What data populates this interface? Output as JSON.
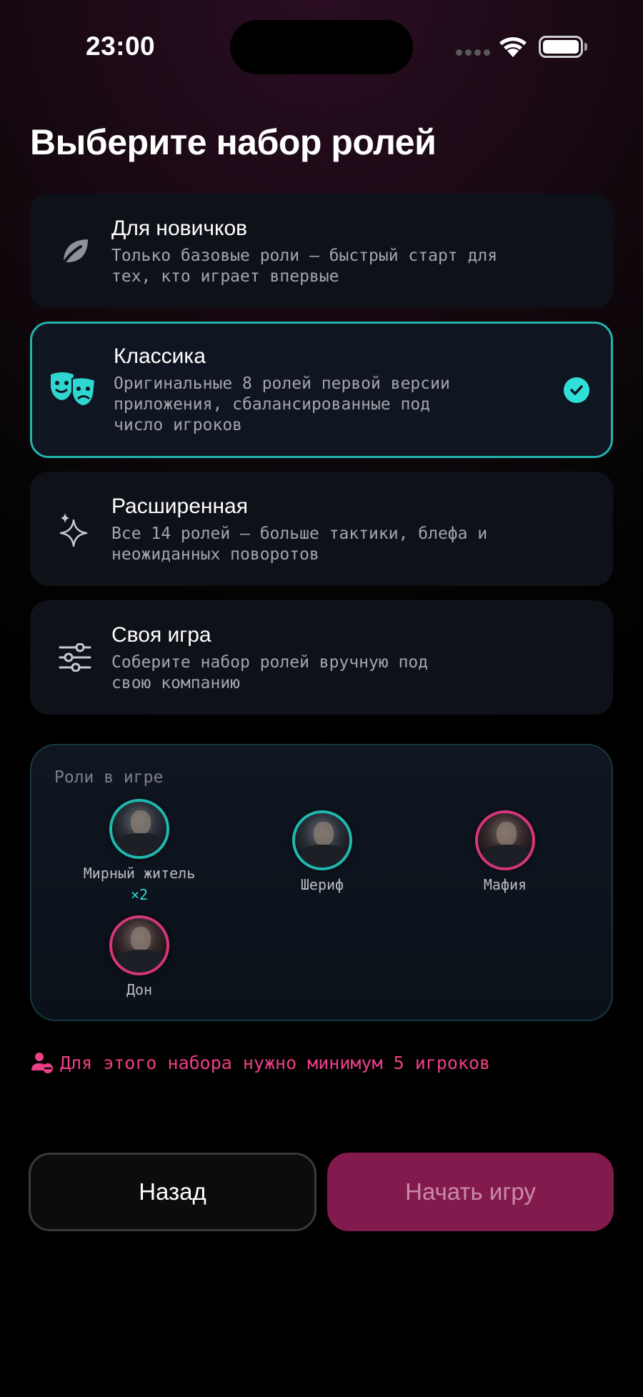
{
  "status_bar": {
    "time": "23:00"
  },
  "title": "Выберите набор ролей",
  "options": [
    {
      "name": "Для новичков",
      "description": "Только базовые роли — быстрый старт для\nтех, кто играет впервые",
      "icon": "leaf-icon",
      "selected": false
    },
    {
      "name": "Классика",
      "description": "Оригинальные 8 ролей первой версии\nприложения, сбалансированные под\nчисло игроков",
      "icon": "theater-masks-icon",
      "selected": true
    },
    {
      "name": "Расширенная",
      "description": "Все 14 ролей — больше тактики, блефа и\nнеожиданных поворотов",
      "icon": "sparkles-icon",
      "selected": false
    },
    {
      "name": "Своя игра",
      "description": "Соберите набор ролей вручную под\nсвою компанию",
      "icon": "sliders-icon",
      "selected": false
    }
  ],
  "roles_panel": {
    "label": "Роли в игре",
    "roles": [
      {
        "name": "Мирный житель",
        "count": "×2",
        "team": "town"
      },
      {
        "name": "Шериф",
        "count": "",
        "team": "town"
      },
      {
        "name": "Мафия",
        "count": "",
        "team": "mafia"
      },
      {
        "name": "Дон",
        "count": "",
        "team": "mafia"
      }
    ]
  },
  "warning": {
    "text": "Для этого набора нужно минимум 5 игроков",
    "icon": "user-minus-icon"
  },
  "buttons": {
    "back": "Назад",
    "start": "Начать игру"
  },
  "colors": {
    "accent_teal": "#2fe0d8",
    "accent_pink": "#ec3f86",
    "start_button": "#831a4d"
  }
}
